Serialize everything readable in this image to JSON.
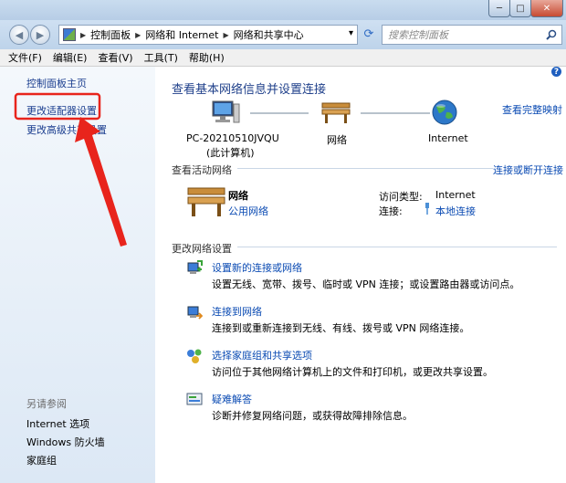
{
  "window": {
    "minimize_glyph": "─",
    "maximize_glyph": "□",
    "close_glyph": "✕"
  },
  "address": {
    "back_glyph": "◀",
    "forward_glyph": "▶",
    "crumbs": [
      "控制面板",
      "网络和 Internet",
      "网络和共享中心"
    ],
    "dropdown_glyph": "▾",
    "refresh_glyph": "⟳",
    "search_placeholder": "搜索控制面板"
  },
  "menu": [
    "文件(F)",
    "编辑(E)",
    "查看(V)",
    "工具(T)",
    "帮助(H)"
  ],
  "sidebar": {
    "links": [
      "控制面板主页",
      "更改适配器设置",
      "更改高级共享设置"
    ],
    "see_also_label": "另请参阅",
    "see_also": [
      "Internet 选项",
      "Windows 防火墙",
      "家庭组"
    ]
  },
  "main": {
    "help_glyph": "?",
    "title": "查看基本网络信息并设置连接",
    "view_full_map": "查看完整映射",
    "map": {
      "pc_name": "PC-20210510JVQU",
      "pc_sub": "(此计算机)",
      "network": "网络",
      "internet": "Internet"
    },
    "active_networks": {
      "heading": "查看活动网络",
      "connect_link": "连接或断开连接",
      "network_name": "网络",
      "network_type": "公用网络",
      "access_type_label": "访问类型:",
      "access_type_value": "Internet",
      "connection_label": "连接:",
      "connection_value": "本地连接"
    },
    "change_settings": {
      "heading": "更改网络设置",
      "items": [
        {
          "title": "设置新的连接或网络",
          "desc": "设置无线、宽带、拨号、临时或 VPN 连接；或设置路由器或访问点。",
          "icon": "new-connection-icon"
        },
        {
          "title": "连接到网络",
          "desc": "连接到或重新连接到无线、有线、拨号或 VPN 网络连接。",
          "icon": "connect-network-icon"
        },
        {
          "title": "选择家庭组和共享选项",
          "desc": "访问位于其他网络计算机上的文件和打印机，或更改共享设置。",
          "icon": "homegroup-icon"
        },
        {
          "title": "疑难解答",
          "desc": "诊断并修复网络问题，或获得故障排除信息。",
          "icon": "troubleshoot-icon"
        }
      ]
    }
  },
  "annotation_color": "#e8241c"
}
